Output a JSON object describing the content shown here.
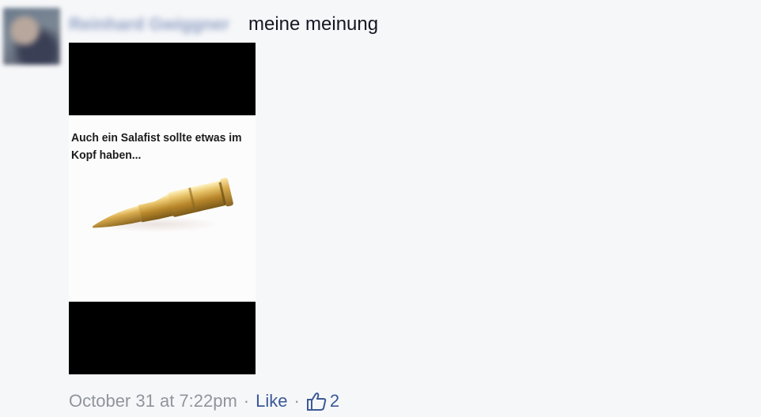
{
  "comment": {
    "author": "Reinhard Gwiggner",
    "text": "meine meinung",
    "attachment": {
      "caption": "Auch ein Salafist sollte etwas im Kopf haben..."
    },
    "meta": {
      "timestamp": "October 31 at 7:22pm",
      "separator": "·",
      "like_label": "Like",
      "like_count": "2",
      "like_icon": "thumbs-up-icon"
    }
  },
  "colors": {
    "background": "#f6f7f9",
    "link": "#3b5998",
    "meta": "#90949c",
    "text": "#141823"
  }
}
